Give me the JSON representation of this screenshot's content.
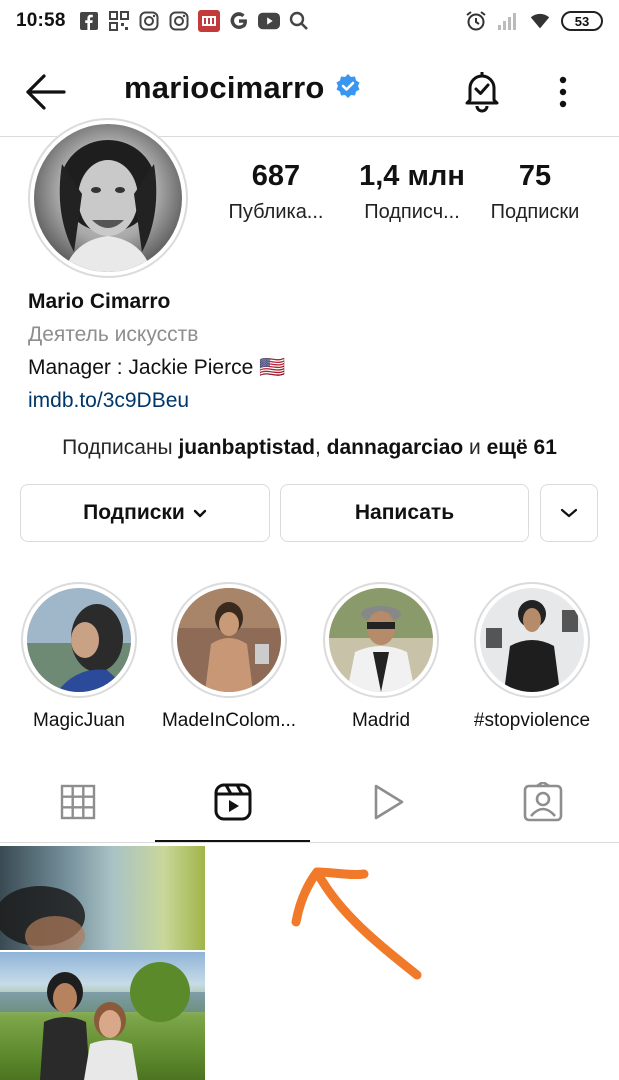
{
  "status_bar": {
    "time": "10:58",
    "battery": "53",
    "icons_left": [
      "facebook-icon",
      "qr-icon",
      "instagram-icon",
      "instagram-icon",
      "mi-app-icon",
      "google-icon",
      "youtube-icon",
      "search-icon"
    ],
    "icons_right": [
      "alarm-icon",
      "signal-icon",
      "wifi-icon",
      "battery-icon"
    ]
  },
  "header": {
    "username": "mariocimarro",
    "verified": true,
    "accent_color": "#3897f0"
  },
  "profile": {
    "stats": [
      {
        "value": "687",
        "label": "Публика..."
      },
      {
        "value": "1,4 млн",
        "label": "Подписч..."
      },
      {
        "value": "75",
        "label": "Подписки"
      }
    ],
    "name": "Mario Cimarro",
    "category": "Деятель искусств",
    "bio_line": "Manager : Jackie Pierce 🇺🇸",
    "link": "imdb.to/3c9DBeu",
    "link_color": "#00376b"
  },
  "followed_by": {
    "prefix": "Подписаны ",
    "user1": "juanbaptistad",
    "sep": ", ",
    "user2": "dannagarciao",
    "and": " и ",
    "more": "ещё 61"
  },
  "buttons": {
    "following": "Подписки",
    "message": "Написать"
  },
  "highlights": [
    {
      "label": "MagicJuan"
    },
    {
      "label": "MadeInColom..."
    },
    {
      "label": "Madrid"
    },
    {
      "label": "#stopviolence"
    }
  ],
  "tabs": {
    "items": [
      "grid-icon",
      "reels-icon",
      "play-icon",
      "tagged-icon"
    ],
    "active_index": 1
  },
  "annotation": {
    "arrow_color": "#f07a2a"
  }
}
